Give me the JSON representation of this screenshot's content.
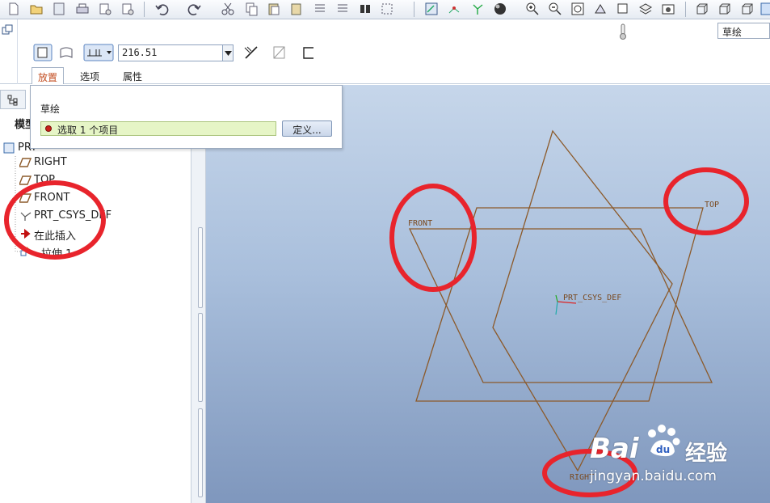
{
  "dashboard": {
    "depth_value": "216.51",
    "tabs": [
      "放置",
      "选项",
      "属性"
    ],
    "filter_value": "草绘"
  },
  "popup": {
    "title": "草绘",
    "collector_text": "选取 1 个项目",
    "define_label": "定义..."
  },
  "model_tree": {
    "tab_label": "模型",
    "root_label": "PRT",
    "items": [
      "RIGHT",
      "TOP",
      "FRONT",
      "PRT_CSYS_DEF",
      "在此插入",
      "拉伸 1"
    ]
  },
  "canvas": {
    "plane_labels": {
      "front": "FRONT",
      "top": "TOP",
      "right": "RIGHT"
    },
    "csys_label": "PRT_CSYS_DEF"
  },
  "watermark": {
    "brand": "Bai",
    "brand_cn": "经验",
    "url": "jingyan.baidu.com"
  },
  "colors": {
    "datum_plane": "#8c5a2a",
    "annotation_circle": "#e8242c",
    "canvas_top": "#c6d6ea",
    "canvas_bottom": "#7f97bd",
    "active_tab": "#c24b1e"
  }
}
